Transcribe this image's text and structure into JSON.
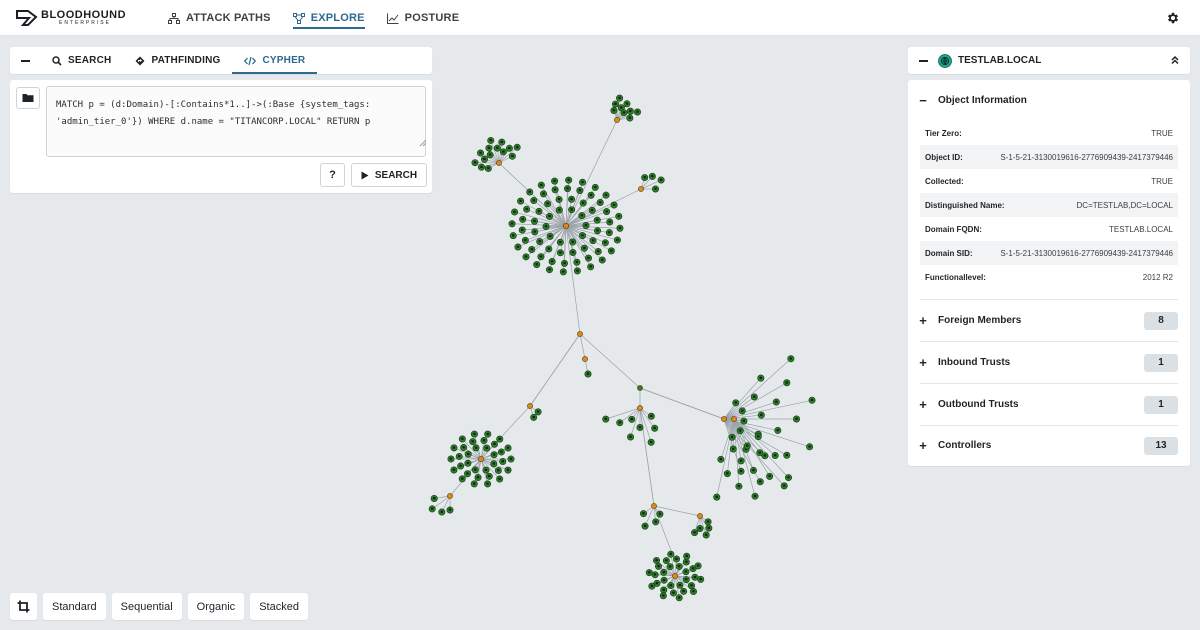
{
  "brand": {
    "name": "BLOODHOUND",
    "subtitle": "ENTERPRISE"
  },
  "nav": [
    {
      "label": "ATTACK PATHS",
      "icon": "attack-paths-icon",
      "active": false
    },
    {
      "label": "EXPLORE",
      "icon": "explore-icon",
      "active": true
    },
    {
      "label": "POSTURE",
      "icon": "posture-icon",
      "active": false
    }
  ],
  "search_tabs": [
    {
      "label": "SEARCH",
      "icon": "search-icon"
    },
    {
      "label": "PATHFINDING",
      "icon": "pathfinding-icon"
    },
    {
      "label": "CYPHER",
      "icon": "code-icon",
      "active": true
    }
  ],
  "query": {
    "text": "MATCH p = (d:Domain)-[:Contains*1..]->(:Base {system_tags:\n'admin_tier_0'}) WHERE d.name = \"TITANCORP.LOCAL\" RETURN p"
  },
  "buttons": {
    "help": "?",
    "search": "SEARCH"
  },
  "entity": {
    "title": "TESTLAB.LOCAL",
    "icon": "domain-globe-icon",
    "section_title": "Object Information",
    "properties": [
      {
        "key": "Tier Zero:",
        "value": "TRUE"
      },
      {
        "key": "Object ID:",
        "value": "S-1-5-21-3130019616-2776909439-2417379446"
      },
      {
        "key": "Collected:",
        "value": "TRUE"
      },
      {
        "key": "Distinguished Name:",
        "value": "DC=TESTLAB,DC=LOCAL"
      },
      {
        "key": "Domain FQDN:",
        "value": "TESTLAB.LOCAL"
      },
      {
        "key": "Domain SID:",
        "value": "S-1-5-21-3130019616-2776909439-2417379446"
      },
      {
        "key": "Functionallevel:",
        "value": "2012 R2"
      }
    ],
    "sections": [
      {
        "label": "Foreign Members",
        "count": "8"
      },
      {
        "label": "Inbound Trusts",
        "count": "1"
      },
      {
        "label": "Outbound Trusts",
        "count": "1"
      },
      {
        "label": "Controllers",
        "count": "13"
      }
    ]
  },
  "layouts": [
    "Standard",
    "Sequential",
    "Organic",
    "Stacked"
  ],
  "colors": {
    "accent": "#2d6a8d",
    "node_green": "#2f7d2c",
    "node_orange": "#d98c1a",
    "node_red": "#a8322a",
    "edge": "#9aa3a9",
    "domain_teal": "#19a88b"
  }
}
